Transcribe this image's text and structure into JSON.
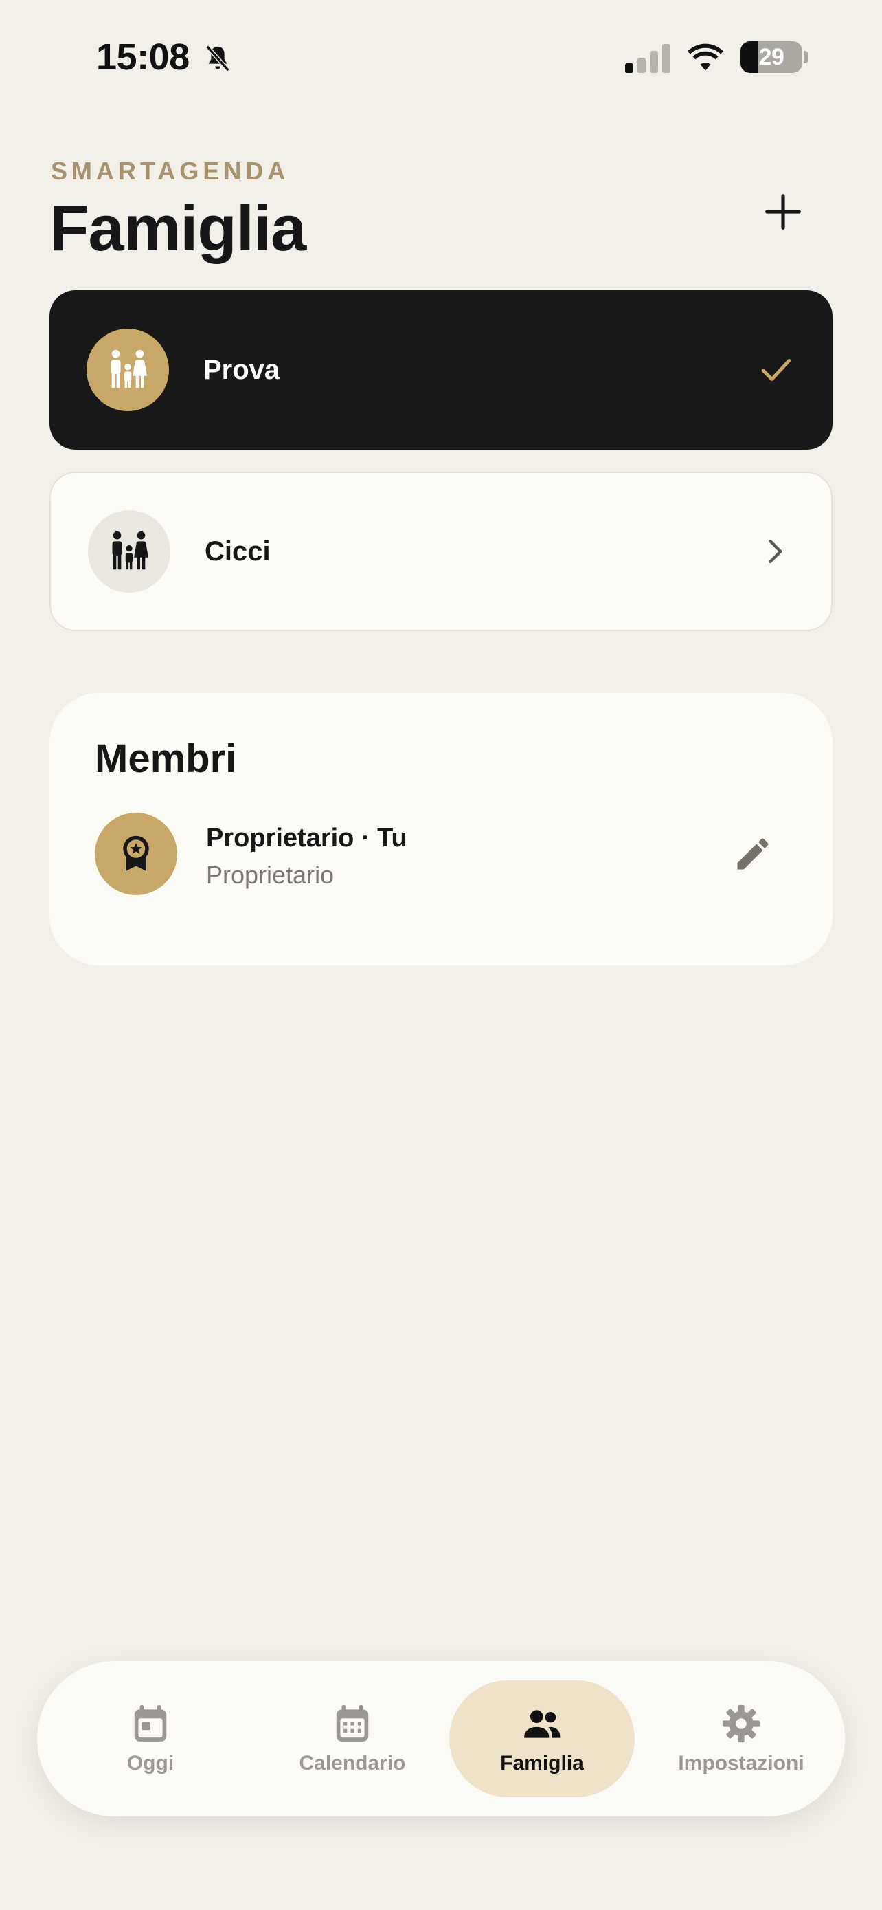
{
  "status_bar": {
    "time": "15:08",
    "battery_percent": "29",
    "battery_level": 0.29,
    "silent_icon": "bell-slash-icon"
  },
  "header": {
    "eyebrow": "SMARTAGENDA",
    "title": "Famiglia",
    "add_icon": "plus-icon"
  },
  "families": [
    {
      "name": "Prova",
      "selected": true,
      "icon": "family-icon",
      "trailing_icon": "checkmark-icon"
    },
    {
      "name": "Cicci",
      "selected": false,
      "icon": "family-icon",
      "trailing_icon": "chevron-right-icon"
    }
  ],
  "members": {
    "title": "Membri",
    "items": [
      {
        "name": "Proprietario · Tu",
        "role": "Proprietario",
        "icon": "owner-badge-icon",
        "action_icon": "pencil-icon"
      }
    ]
  },
  "tabbar": {
    "tabs": [
      {
        "label": "Oggi",
        "icon": "today-calendar-icon",
        "selected": false
      },
      {
        "label": "Calendario",
        "icon": "calendar-grid-icon",
        "selected": false
      },
      {
        "label": "Famiglia",
        "icon": "people-icon",
        "selected": true
      },
      {
        "label": "Impostazioni",
        "icon": "gear-icon",
        "selected": false
      }
    ]
  },
  "colors": {
    "background": "#F2EFE9",
    "accent_gold": "#C9A769",
    "eyebrow": "#A8916D",
    "card_dark": "#181818",
    "card_light": "#FDFBF6",
    "selected_tab": "#F0E2C8"
  }
}
